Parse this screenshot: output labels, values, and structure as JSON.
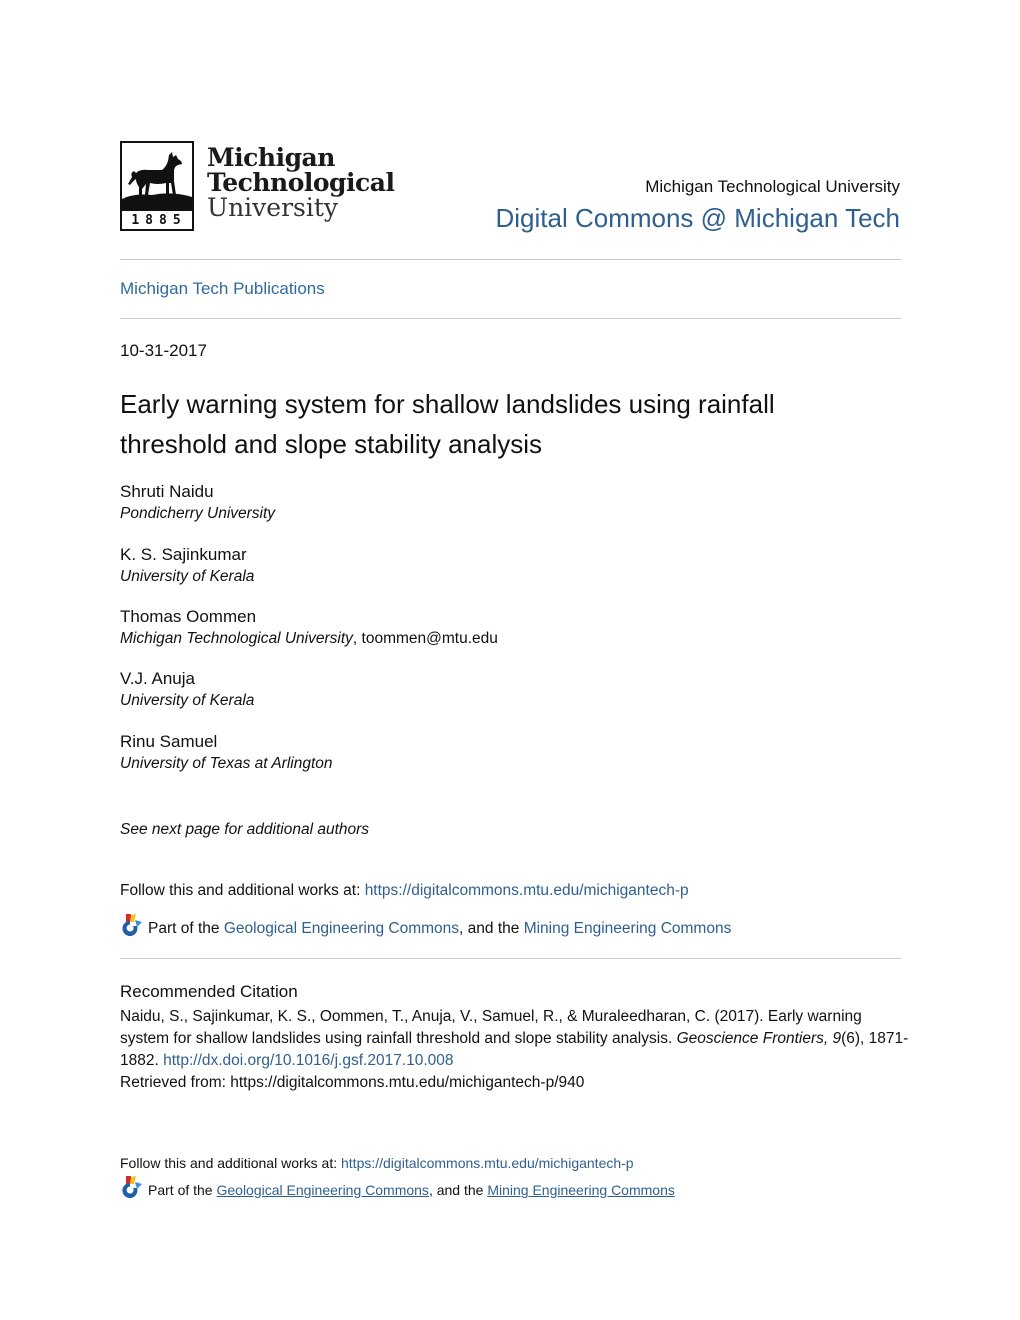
{
  "header": {
    "logo": {
      "line1": "Michigan",
      "line2": "Technological",
      "line3": "University",
      "year": "1885",
      "icon": "husky-logo-icon"
    },
    "institution": "Michigan Technological University",
    "repository": "Digital Commons @ Michigan Tech"
  },
  "collection": "Michigan Tech Publications",
  "date": "10-31-2017",
  "title": "Early warning system for shallow landslides using rainfall threshold and slope stability analysis",
  "authors": [
    {
      "name": "Shruti Naidu",
      "affiliation": "Pondicherry University"
    },
    {
      "name": "K. S. Sajinkumar",
      "affiliation": "University of Kerala"
    },
    {
      "name": "Thomas Oommen",
      "affiliation": "Michigan Technological University",
      "email": ", toommen@mtu.edu"
    },
    {
      "name": "V.J. Anuja",
      "affiliation": "University of Kerala"
    },
    {
      "name": "Rinu Samuel",
      "affiliation": "University of Texas at Arlington"
    }
  ],
  "more_authors": "See next page for additional authors",
  "follow": {
    "prefix": "Follow this and additional works at: ",
    "url": "https://digitalcommons.mtu.edu/michigantech-p"
  },
  "part_of": {
    "prefix": "Part of the ",
    "link1": "Geological Engineering Commons",
    "middle": ", and the ",
    "link2": "Mining Engineering Commons",
    "icon": "digital-commons-network-icon"
  },
  "citation": {
    "heading": "Recommended Citation",
    "text1": "Naidu, S., Sajinkumar, K. S., Oommen, T., Anuja, V., Samuel, R., & Muraleedharan, C. (2017). Early warning system for shallow landslides using rainfall threshold and slope stability analysis. ",
    "journal": "Geoscience Frontiers, 9",
    "text2": "(6), 1871-1882. ",
    "doi": "http://dx.doi.org/10.1016/j.gsf.2017.10.008",
    "retrieved": "Retrieved from: https://digitalcommons.mtu.edu/michigantech-p/940"
  },
  "colors": {
    "link": "#2f5f8f",
    "text": "#111111",
    "rule": "#c8c8c8"
  }
}
